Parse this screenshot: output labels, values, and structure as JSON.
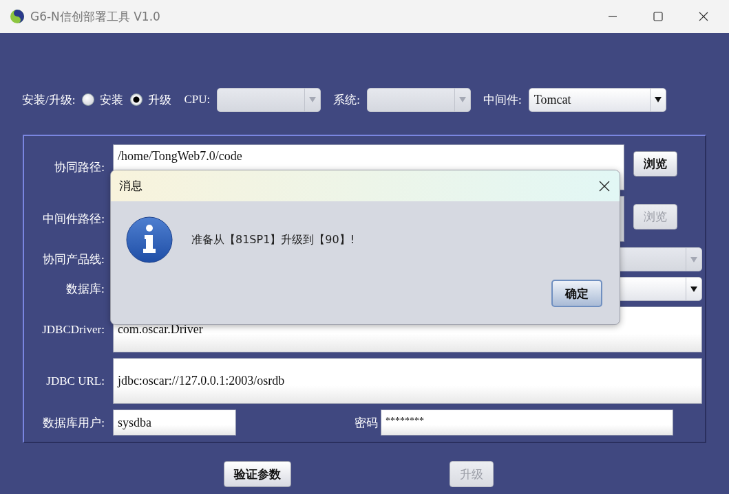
{
  "window": {
    "title": "G6-N信创部署工具 V1.0"
  },
  "mode": {
    "label": "安装/升级:",
    "options": [
      {
        "label": "安装",
        "selected": false
      },
      {
        "label": "升级",
        "selected": true
      }
    ]
  },
  "selectors": [
    {
      "label": "CPU:",
      "disabled": true
    },
    {
      "label": "系统:",
      "disabled": true
    },
    {
      "label": "中间件:",
      "value": "Tomcat",
      "disabled": false
    }
  ],
  "form": [
    {
      "kind": "path",
      "label": "协同路径:",
      "value": "/home/TongWeb7.0/code",
      "disabled": false,
      "button": {
        "label": "浏览",
        "disabled": false
      }
    },
    {
      "kind": "path",
      "label": "中间件路径:",
      "disabled": true,
      "button": {
        "label": "浏览",
        "disabled": true
      }
    },
    {
      "kind": "combo",
      "label": "协同产品线:",
      "disabled": true
    },
    {
      "kind": "combo",
      "label": "数据库:",
      "disabled": false
    },
    {
      "kind": "text",
      "label": "JDBCDriver:",
      "value": "com.oscar.Driver"
    },
    {
      "kind": "text",
      "label": "JDBC URL:",
      "value": "jdbc:oscar://127.0.0.1:2003/osrdb"
    }
  ],
  "credentials": {
    "user_label": "数据库用户:",
    "user": "sysdba",
    "password_label": "密码",
    "password": "********"
  },
  "buttons": [
    {
      "label": "验证参数",
      "disabled": false
    },
    {
      "label": "升级",
      "disabled": true
    }
  ],
  "dialog": {
    "title": "消息",
    "message": "准备从【81SP1】升级到【90】!",
    "button": "确定"
  }
}
